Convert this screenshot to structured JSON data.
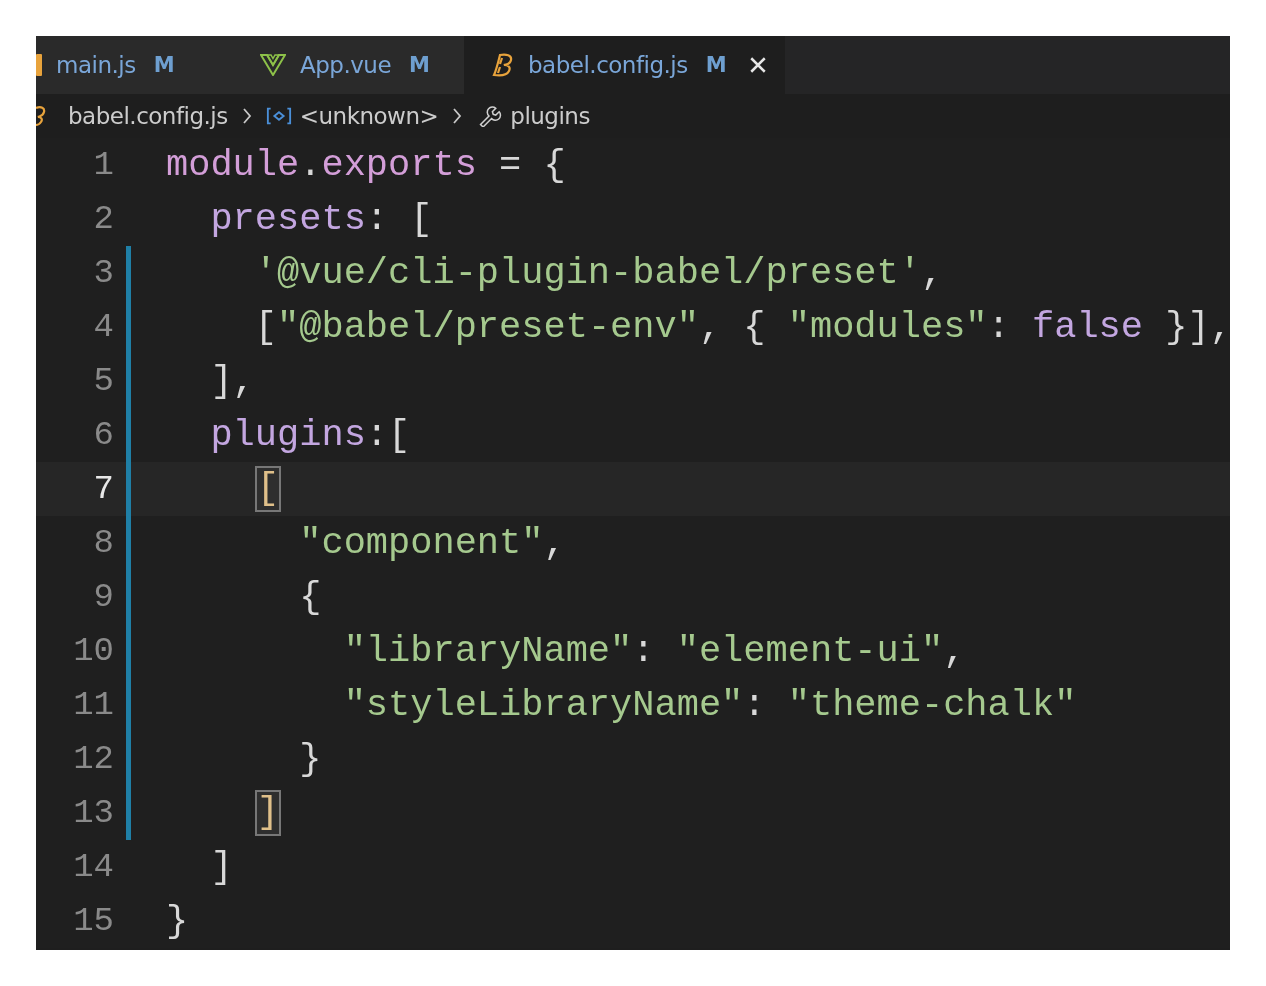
{
  "tabs": [
    {
      "label": "main.js",
      "status": "M",
      "kind": "js",
      "selected": false,
      "closable": false
    },
    {
      "label": "App.vue",
      "status": "M",
      "kind": "vue",
      "selected": false,
      "closable": false
    },
    {
      "label": "babel.config.js",
      "status": "M",
      "kind": "babel",
      "selected": true,
      "closable": true
    }
  ],
  "breadcrumb": [
    {
      "label": "babel.config.js",
      "kind": "file"
    },
    {
      "label": "<unknown>",
      "kind": "object"
    },
    {
      "label": "plugins",
      "kind": "property"
    }
  ],
  "lines": [
    {
      "number": "1",
      "current": false,
      "modified": false,
      "tokens": [
        {
          "text": "module",
          "kind": "variable"
        },
        {
          "text": ".",
          "kind": "punct"
        },
        {
          "text": "exports",
          "kind": "variable"
        },
        {
          "text": " = {",
          "kind": "punct"
        }
      ]
    },
    {
      "number": "2",
      "current": false,
      "modified": false,
      "tokens": [
        {
          "text": "  presets",
          "kind": "property"
        },
        {
          "text": ": [",
          "kind": "punct"
        }
      ]
    },
    {
      "number": "3",
      "current": false,
      "modified": true,
      "tokens": [
        {
          "text": "    '@vue/cli-plugin-babel/preset'",
          "kind": "string"
        },
        {
          "text": ",",
          "kind": "punct"
        }
      ]
    },
    {
      "number": "4",
      "current": false,
      "modified": true,
      "tokens": [
        {
          "text": "    [",
          "kind": "punct"
        },
        {
          "text": "\"@babel/preset-env\"",
          "kind": "string"
        },
        {
          "text": ", { ",
          "kind": "punct"
        },
        {
          "text": "\"modules\"",
          "kind": "string"
        },
        {
          "text": ": ",
          "kind": "punct"
        },
        {
          "text": "false",
          "kind": "boolean"
        },
        {
          "text": " }],",
          "kind": "punct"
        }
      ]
    },
    {
      "number": "5",
      "current": false,
      "modified": true,
      "tokens": [
        {
          "text": "  ],",
          "kind": "punct"
        }
      ]
    },
    {
      "number": "6",
      "current": false,
      "modified": true,
      "tokens": [
        {
          "text": "  plugins",
          "kind": "property"
        },
        {
          "text": ":[",
          "kind": "punct"
        }
      ]
    },
    {
      "number": "7",
      "current": true,
      "modified": true,
      "tokens": [
        {
          "text": "[",
          "kind": "bracket-match"
        }
      ]
    },
    {
      "number": "8",
      "current": false,
      "modified": true,
      "tokens": [
        {
          "text": "      \"component\"",
          "kind": "string"
        },
        {
          "text": ",",
          "kind": "punct"
        }
      ]
    },
    {
      "number": "9",
      "current": false,
      "modified": true,
      "tokens": [
        {
          "text": "      {",
          "kind": "punct"
        }
      ]
    },
    {
      "number": "10",
      "current": false,
      "modified": true,
      "tokens": [
        {
          "text": "        \"libraryName\"",
          "kind": "string"
        },
        {
          "text": ": ",
          "kind": "punct"
        },
        {
          "text": "\"element-ui\"",
          "kind": "string"
        },
        {
          "text": ",",
          "kind": "punct"
        }
      ]
    },
    {
      "number": "11",
      "current": false,
      "modified": true,
      "tokens": [
        {
          "text": "        \"styleLibraryName\"",
          "kind": "string"
        },
        {
          "text": ": ",
          "kind": "punct"
        },
        {
          "text": "\"theme-chalk\"",
          "kind": "string"
        }
      ]
    },
    {
      "number": "12",
      "current": false,
      "modified": true,
      "tokens": [
        {
          "text": "      }",
          "kind": "punct"
        }
      ]
    },
    {
      "number": "13",
      "current": false,
      "modified": true,
      "tokens": [
        {
          "text": "]",
          "kind": "bracket-match"
        }
      ]
    },
    {
      "number": "14",
      "current": false,
      "modified": false,
      "tokens": [
        {
          "text": "  ]",
          "kind": "punct"
        }
      ]
    },
    {
      "number": "15",
      "current": false,
      "modified": false,
      "tokens": [
        {
          "text": "}",
          "kind": "punct"
        }
      ]
    }
  ]
}
